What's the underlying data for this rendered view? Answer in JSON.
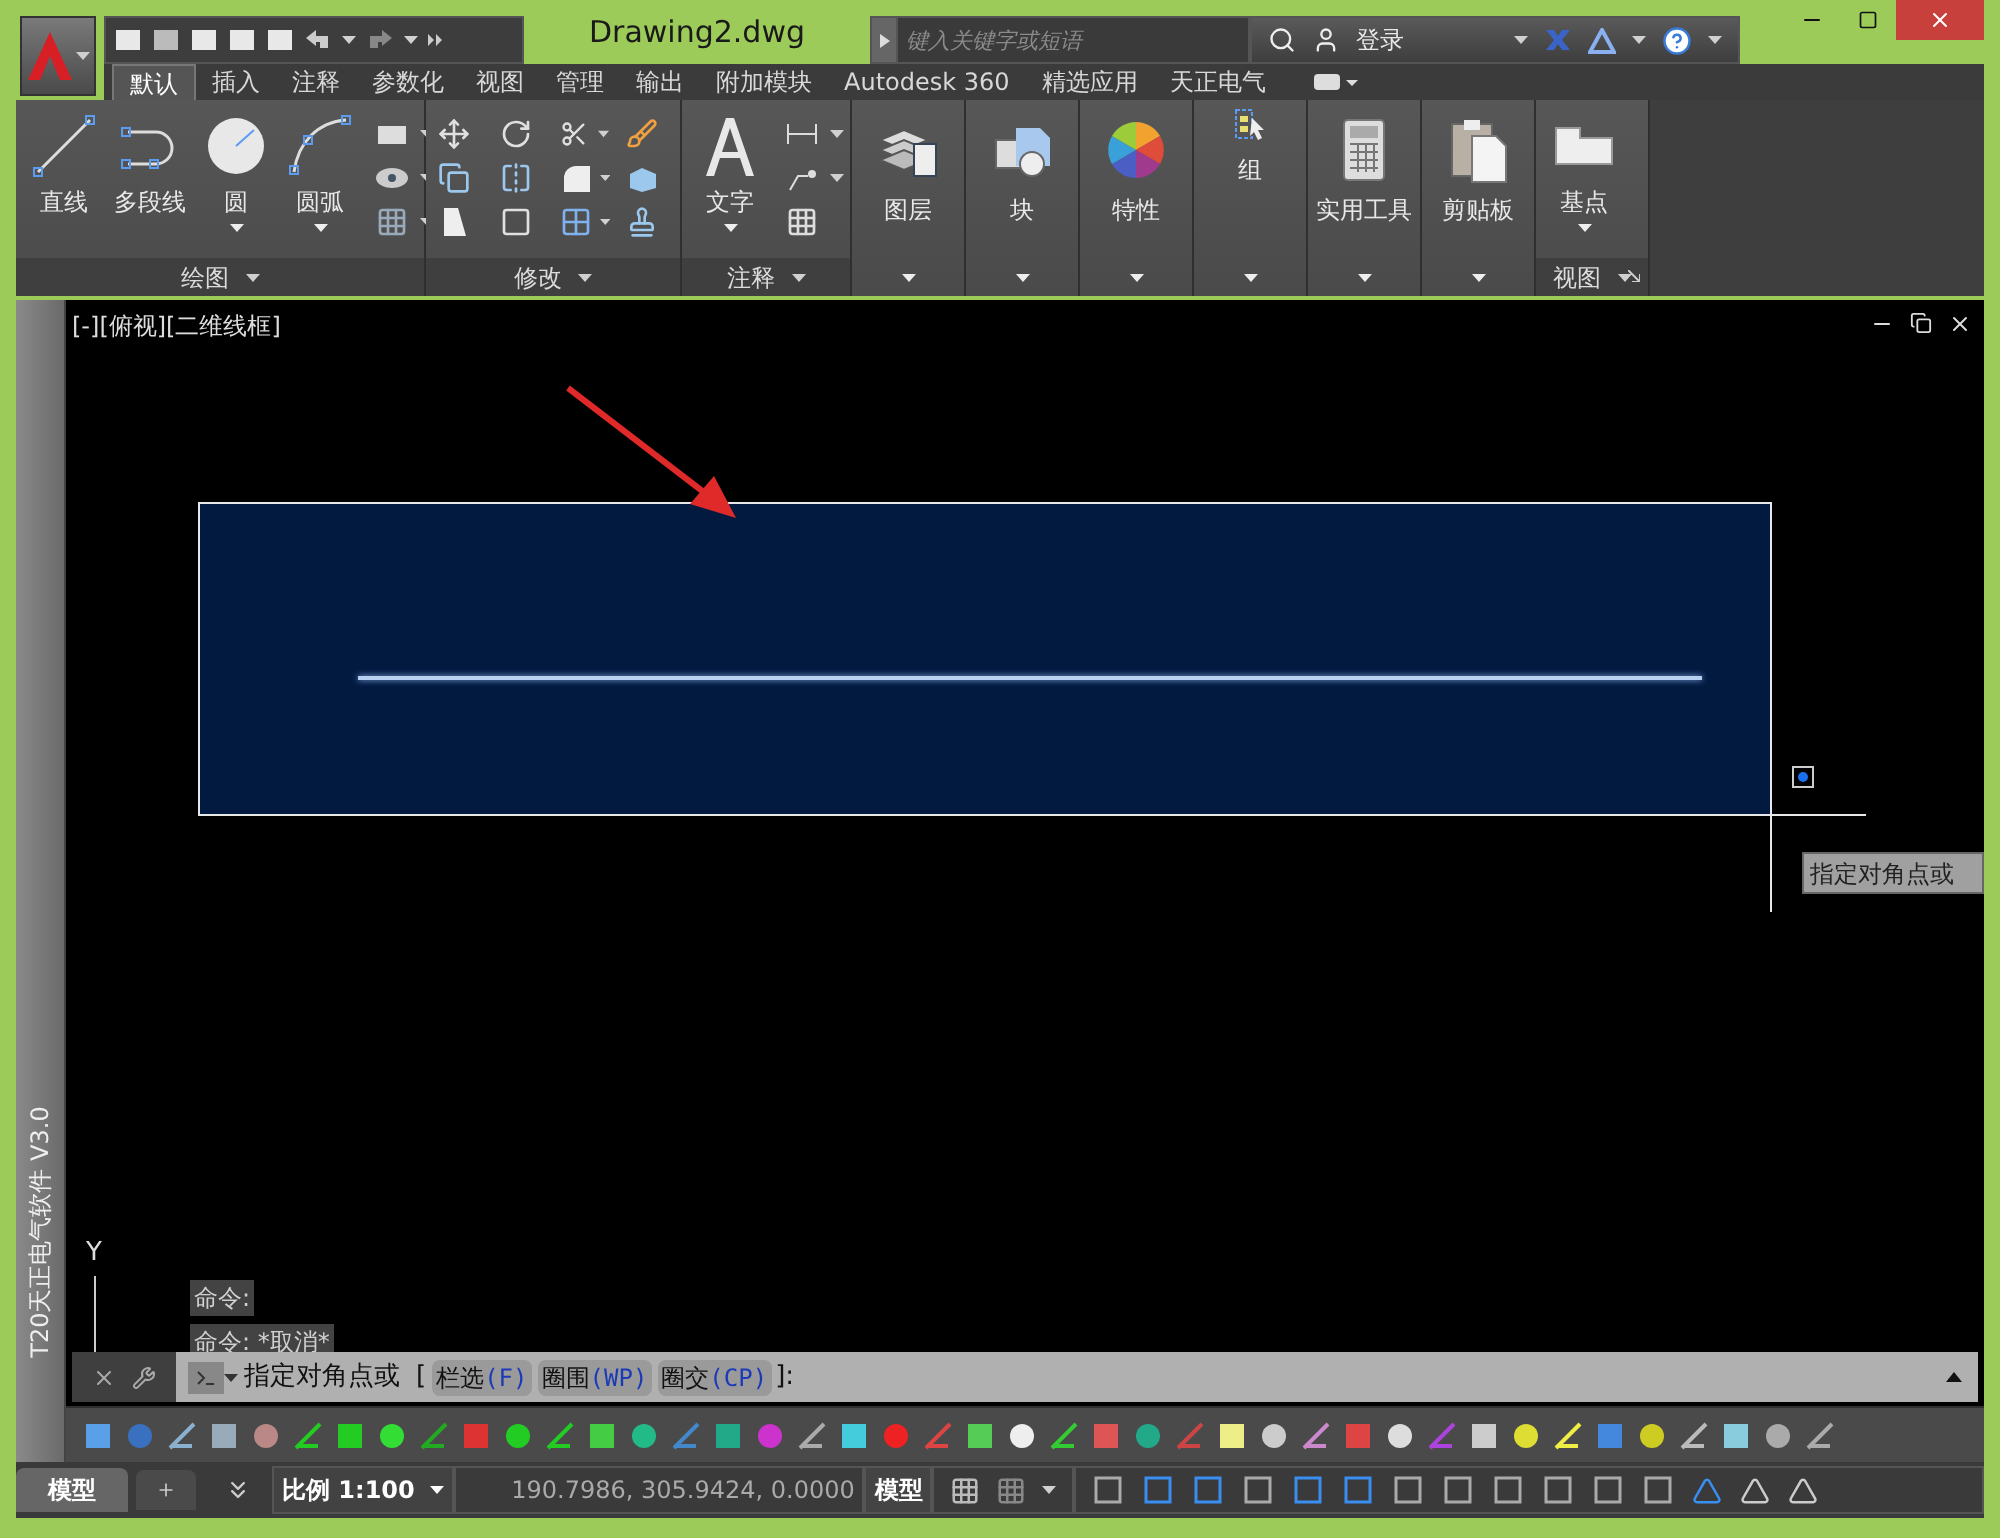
{
  "app": {
    "title": "Drawing2.dwg",
    "search": {
      "placeholder": "键入关键字或短语"
    },
    "sign_in": "登录"
  },
  "tabs": [
    {
      "label": "默认",
      "selected": true
    },
    {
      "label": "插入",
      "selected": false
    },
    {
      "label": "注释",
      "selected": false
    },
    {
      "label": "参数化",
      "selected": false
    },
    {
      "label": "视图",
      "selected": false
    },
    {
      "label": "管理",
      "selected": false
    },
    {
      "label": "输出",
      "selected": false
    },
    {
      "label": "附加模块",
      "selected": false
    },
    {
      "label": "Autodesk 360",
      "selected": false
    },
    {
      "label": "精选应用",
      "selected": false
    },
    {
      "label": "天正电气",
      "selected": false
    }
  ],
  "ribbon": {
    "panels": [
      {
        "kind": "tools",
        "title": "绘图",
        "buttons": [
          "直线",
          "多段线",
          "圆",
          "圆弧"
        ]
      },
      {
        "kind": "tools",
        "title": "修改"
      },
      {
        "kind": "tools",
        "title": "注释",
        "buttons": [
          "文字"
        ]
      },
      {
        "kind": "single",
        "label": "图层"
      },
      {
        "kind": "single",
        "label": "块"
      },
      {
        "kind": "single",
        "label": "特性"
      },
      {
        "kind": "single",
        "label": "组"
      },
      {
        "kind": "single",
        "label": "实用工具"
      },
      {
        "kind": "single",
        "label": "剪贴板"
      },
      {
        "kind": "tools",
        "title": "视图",
        "buttons": [
          "基点"
        ]
      }
    ]
  },
  "palette": {
    "title": "T20天正电气软件 V3.0"
  },
  "viewport": {
    "label": "[-][俯视][二维线框]",
    "tooltip": "指定对角点或",
    "ucs_label": "Y"
  },
  "command": {
    "history": [
      "命令:",
      "命令: *取消*"
    ],
    "prompt": "指定对角点或",
    "open": "[",
    "options": [
      {
        "label": "栏选",
        "key": "(F)"
      },
      {
        "label": "圈围",
        "key": "(WP)"
      },
      {
        "label": "圈交",
        "key": "(CP)"
      }
    ],
    "close": "]:"
  },
  "status_bar": {
    "layout_tabs": [
      {
        "label": "模型",
        "selected": true
      }
    ],
    "scale": "比例 1:100",
    "coordinates": "190.7986, 305.9424, 0.0000",
    "space": "模型"
  }
}
